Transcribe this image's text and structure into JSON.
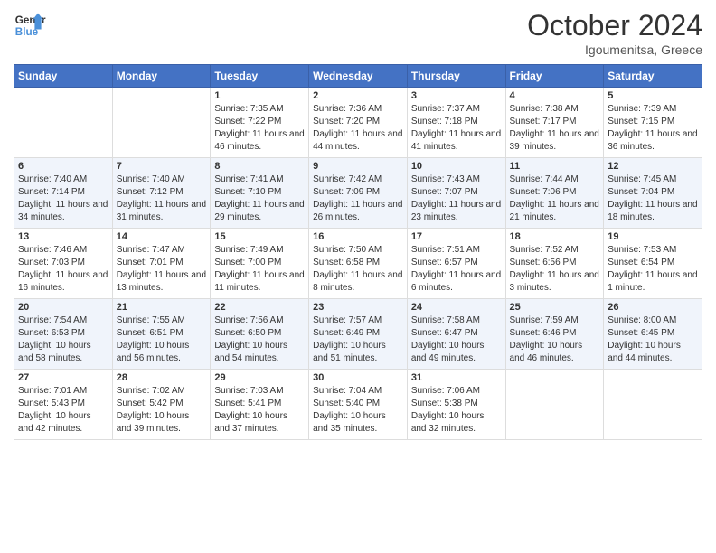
{
  "header": {
    "logo_line1": "General",
    "logo_line2": "Blue",
    "month": "October 2024",
    "location": "Igoumenitsa, Greece"
  },
  "days_of_week": [
    "Sunday",
    "Monday",
    "Tuesday",
    "Wednesday",
    "Thursday",
    "Friday",
    "Saturday"
  ],
  "weeks": [
    [
      {
        "day": "",
        "sunrise": "",
        "sunset": "",
        "daylight": ""
      },
      {
        "day": "",
        "sunrise": "",
        "sunset": "",
        "daylight": ""
      },
      {
        "day": "1",
        "sunrise": "Sunrise: 7:35 AM",
        "sunset": "Sunset: 7:22 PM",
        "daylight": "Daylight: 11 hours and 46 minutes."
      },
      {
        "day": "2",
        "sunrise": "Sunrise: 7:36 AM",
        "sunset": "Sunset: 7:20 PM",
        "daylight": "Daylight: 11 hours and 44 minutes."
      },
      {
        "day": "3",
        "sunrise": "Sunrise: 7:37 AM",
        "sunset": "Sunset: 7:18 PM",
        "daylight": "Daylight: 11 hours and 41 minutes."
      },
      {
        "day": "4",
        "sunrise": "Sunrise: 7:38 AM",
        "sunset": "Sunset: 7:17 PM",
        "daylight": "Daylight: 11 hours and 39 minutes."
      },
      {
        "day": "5",
        "sunrise": "Sunrise: 7:39 AM",
        "sunset": "Sunset: 7:15 PM",
        "daylight": "Daylight: 11 hours and 36 minutes."
      }
    ],
    [
      {
        "day": "6",
        "sunrise": "Sunrise: 7:40 AM",
        "sunset": "Sunset: 7:14 PM",
        "daylight": "Daylight: 11 hours and 34 minutes."
      },
      {
        "day": "7",
        "sunrise": "Sunrise: 7:40 AM",
        "sunset": "Sunset: 7:12 PM",
        "daylight": "Daylight: 11 hours and 31 minutes."
      },
      {
        "day": "8",
        "sunrise": "Sunrise: 7:41 AM",
        "sunset": "Sunset: 7:10 PM",
        "daylight": "Daylight: 11 hours and 29 minutes."
      },
      {
        "day": "9",
        "sunrise": "Sunrise: 7:42 AM",
        "sunset": "Sunset: 7:09 PM",
        "daylight": "Daylight: 11 hours and 26 minutes."
      },
      {
        "day": "10",
        "sunrise": "Sunrise: 7:43 AM",
        "sunset": "Sunset: 7:07 PM",
        "daylight": "Daylight: 11 hours and 23 minutes."
      },
      {
        "day": "11",
        "sunrise": "Sunrise: 7:44 AM",
        "sunset": "Sunset: 7:06 PM",
        "daylight": "Daylight: 11 hours and 21 minutes."
      },
      {
        "day": "12",
        "sunrise": "Sunrise: 7:45 AM",
        "sunset": "Sunset: 7:04 PM",
        "daylight": "Daylight: 11 hours and 18 minutes."
      }
    ],
    [
      {
        "day": "13",
        "sunrise": "Sunrise: 7:46 AM",
        "sunset": "Sunset: 7:03 PM",
        "daylight": "Daylight: 11 hours and 16 minutes."
      },
      {
        "day": "14",
        "sunrise": "Sunrise: 7:47 AM",
        "sunset": "Sunset: 7:01 PM",
        "daylight": "Daylight: 11 hours and 13 minutes."
      },
      {
        "day": "15",
        "sunrise": "Sunrise: 7:49 AM",
        "sunset": "Sunset: 7:00 PM",
        "daylight": "Daylight: 11 hours and 11 minutes."
      },
      {
        "day": "16",
        "sunrise": "Sunrise: 7:50 AM",
        "sunset": "Sunset: 6:58 PM",
        "daylight": "Daylight: 11 hours and 8 minutes."
      },
      {
        "day": "17",
        "sunrise": "Sunrise: 7:51 AM",
        "sunset": "Sunset: 6:57 PM",
        "daylight": "Daylight: 11 hours and 6 minutes."
      },
      {
        "day": "18",
        "sunrise": "Sunrise: 7:52 AM",
        "sunset": "Sunset: 6:56 PM",
        "daylight": "Daylight: 11 hours and 3 minutes."
      },
      {
        "day": "19",
        "sunrise": "Sunrise: 7:53 AM",
        "sunset": "Sunset: 6:54 PM",
        "daylight": "Daylight: 11 hours and 1 minute."
      }
    ],
    [
      {
        "day": "20",
        "sunrise": "Sunrise: 7:54 AM",
        "sunset": "Sunset: 6:53 PM",
        "daylight": "Daylight: 10 hours and 58 minutes."
      },
      {
        "day": "21",
        "sunrise": "Sunrise: 7:55 AM",
        "sunset": "Sunset: 6:51 PM",
        "daylight": "Daylight: 10 hours and 56 minutes."
      },
      {
        "day": "22",
        "sunrise": "Sunrise: 7:56 AM",
        "sunset": "Sunset: 6:50 PM",
        "daylight": "Daylight: 10 hours and 54 minutes."
      },
      {
        "day": "23",
        "sunrise": "Sunrise: 7:57 AM",
        "sunset": "Sunset: 6:49 PM",
        "daylight": "Daylight: 10 hours and 51 minutes."
      },
      {
        "day": "24",
        "sunrise": "Sunrise: 7:58 AM",
        "sunset": "Sunset: 6:47 PM",
        "daylight": "Daylight: 10 hours and 49 minutes."
      },
      {
        "day": "25",
        "sunrise": "Sunrise: 7:59 AM",
        "sunset": "Sunset: 6:46 PM",
        "daylight": "Daylight: 10 hours and 46 minutes."
      },
      {
        "day": "26",
        "sunrise": "Sunrise: 8:00 AM",
        "sunset": "Sunset: 6:45 PM",
        "daylight": "Daylight: 10 hours and 44 minutes."
      }
    ],
    [
      {
        "day": "27",
        "sunrise": "Sunrise: 7:01 AM",
        "sunset": "Sunset: 5:43 PM",
        "daylight": "Daylight: 10 hours and 42 minutes."
      },
      {
        "day": "28",
        "sunrise": "Sunrise: 7:02 AM",
        "sunset": "Sunset: 5:42 PM",
        "daylight": "Daylight: 10 hours and 39 minutes."
      },
      {
        "day": "29",
        "sunrise": "Sunrise: 7:03 AM",
        "sunset": "Sunset: 5:41 PM",
        "daylight": "Daylight: 10 hours and 37 minutes."
      },
      {
        "day": "30",
        "sunrise": "Sunrise: 7:04 AM",
        "sunset": "Sunset: 5:40 PM",
        "daylight": "Daylight: 10 hours and 35 minutes."
      },
      {
        "day": "31",
        "sunrise": "Sunrise: 7:06 AM",
        "sunset": "Sunset: 5:38 PM",
        "daylight": "Daylight: 10 hours and 32 minutes."
      },
      {
        "day": "",
        "sunrise": "",
        "sunset": "",
        "daylight": ""
      },
      {
        "day": "",
        "sunrise": "",
        "sunset": "",
        "daylight": ""
      }
    ]
  ]
}
